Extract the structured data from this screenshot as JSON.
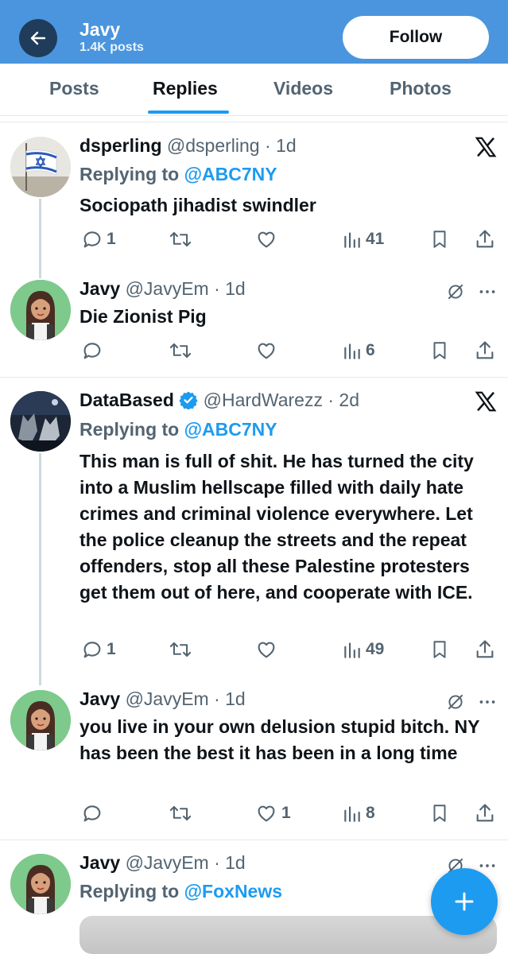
{
  "header": {
    "name": "Javy",
    "post_count": "1.4K posts",
    "follow_label": "Follow"
  },
  "tabs": [
    {
      "label": "Posts"
    },
    {
      "label": "Replies"
    },
    {
      "label": "Videos"
    },
    {
      "label": "Photos"
    }
  ],
  "active_tab": "Replies",
  "posts": [
    {
      "name": "dsperling",
      "handle": "@dsperling",
      "time": "· 1d",
      "replying_prefix": "Replying to",
      "replying_to": "@ABC7NY",
      "text": "Sociopath jihadist swindler",
      "replies": "1",
      "reposts": "",
      "likes": "",
      "views": "41",
      "badge_icon": "x-logo-icon"
    },
    {
      "name": "Javy",
      "handle": "@JavyEm",
      "time": "· 1d",
      "text": "Die Zionist Pig",
      "replies": "",
      "reposts": "",
      "likes": "",
      "views": "6"
    },
    {
      "name": "DataBased",
      "handle": "@HardWarezz",
      "time": "· 2d",
      "verified": true,
      "replying_prefix": "Replying to",
      "replying_to": "@ABC7NY",
      "text": "This man is full of shit. He has turned the city into a Muslim hellscape filled with daily hate crimes and criminal violence everywhere. Let the police cleanup the streets and the repeat offenders, stop all these Palestine protesters get them out of here, and cooperate with ICE.",
      "replies": "1",
      "reposts": "",
      "likes": "",
      "views": "49",
      "badge_icon": "x-logo-icon"
    },
    {
      "name": "Javy",
      "handle": "@JavyEm",
      "time": "· 1d",
      "text": "you live in your own delusion stupid bitch. NY has been the best it has been in a long time",
      "replies": "",
      "reposts": "",
      "likes": "1",
      "views": "8"
    },
    {
      "name": "Javy",
      "handle": "@JavyEm",
      "time": "· 1d",
      "replying_prefix": "Replying to",
      "replying_to": "@FoxNews"
    }
  ],
  "colors": {
    "header_bg": "#4a95dd",
    "accent": "#1d9bf0",
    "secondary_text": "#536471",
    "thread_line": "#cfd9de"
  }
}
